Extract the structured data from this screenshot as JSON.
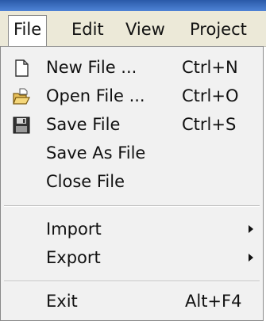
{
  "menubar": {
    "items": [
      {
        "label": "File"
      },
      {
        "label": "Edit"
      },
      {
        "label": "View"
      },
      {
        "label": "Project"
      }
    ]
  },
  "file_menu": {
    "items": [
      {
        "label": "New File ...",
        "shortcut": "Ctrl+N",
        "icon": "new-file-icon"
      },
      {
        "label": "Open File ...",
        "shortcut": "Ctrl+O",
        "icon": "open-folder-icon"
      },
      {
        "label": "Save File",
        "shortcut": "Ctrl+S",
        "icon": "floppy-disk-icon"
      },
      {
        "label": "Save As File"
      },
      {
        "label": "Close File"
      },
      {
        "label": "Import",
        "submenu": true
      },
      {
        "label": "Export",
        "submenu": true
      },
      {
        "label": "Exit",
        "shortcut": "Alt+F4"
      }
    ]
  },
  "colors": {
    "menubar_bg": "#ece9d8",
    "menu_bg": "#f1f1f1",
    "title_strip": "#3a6cc0"
  }
}
